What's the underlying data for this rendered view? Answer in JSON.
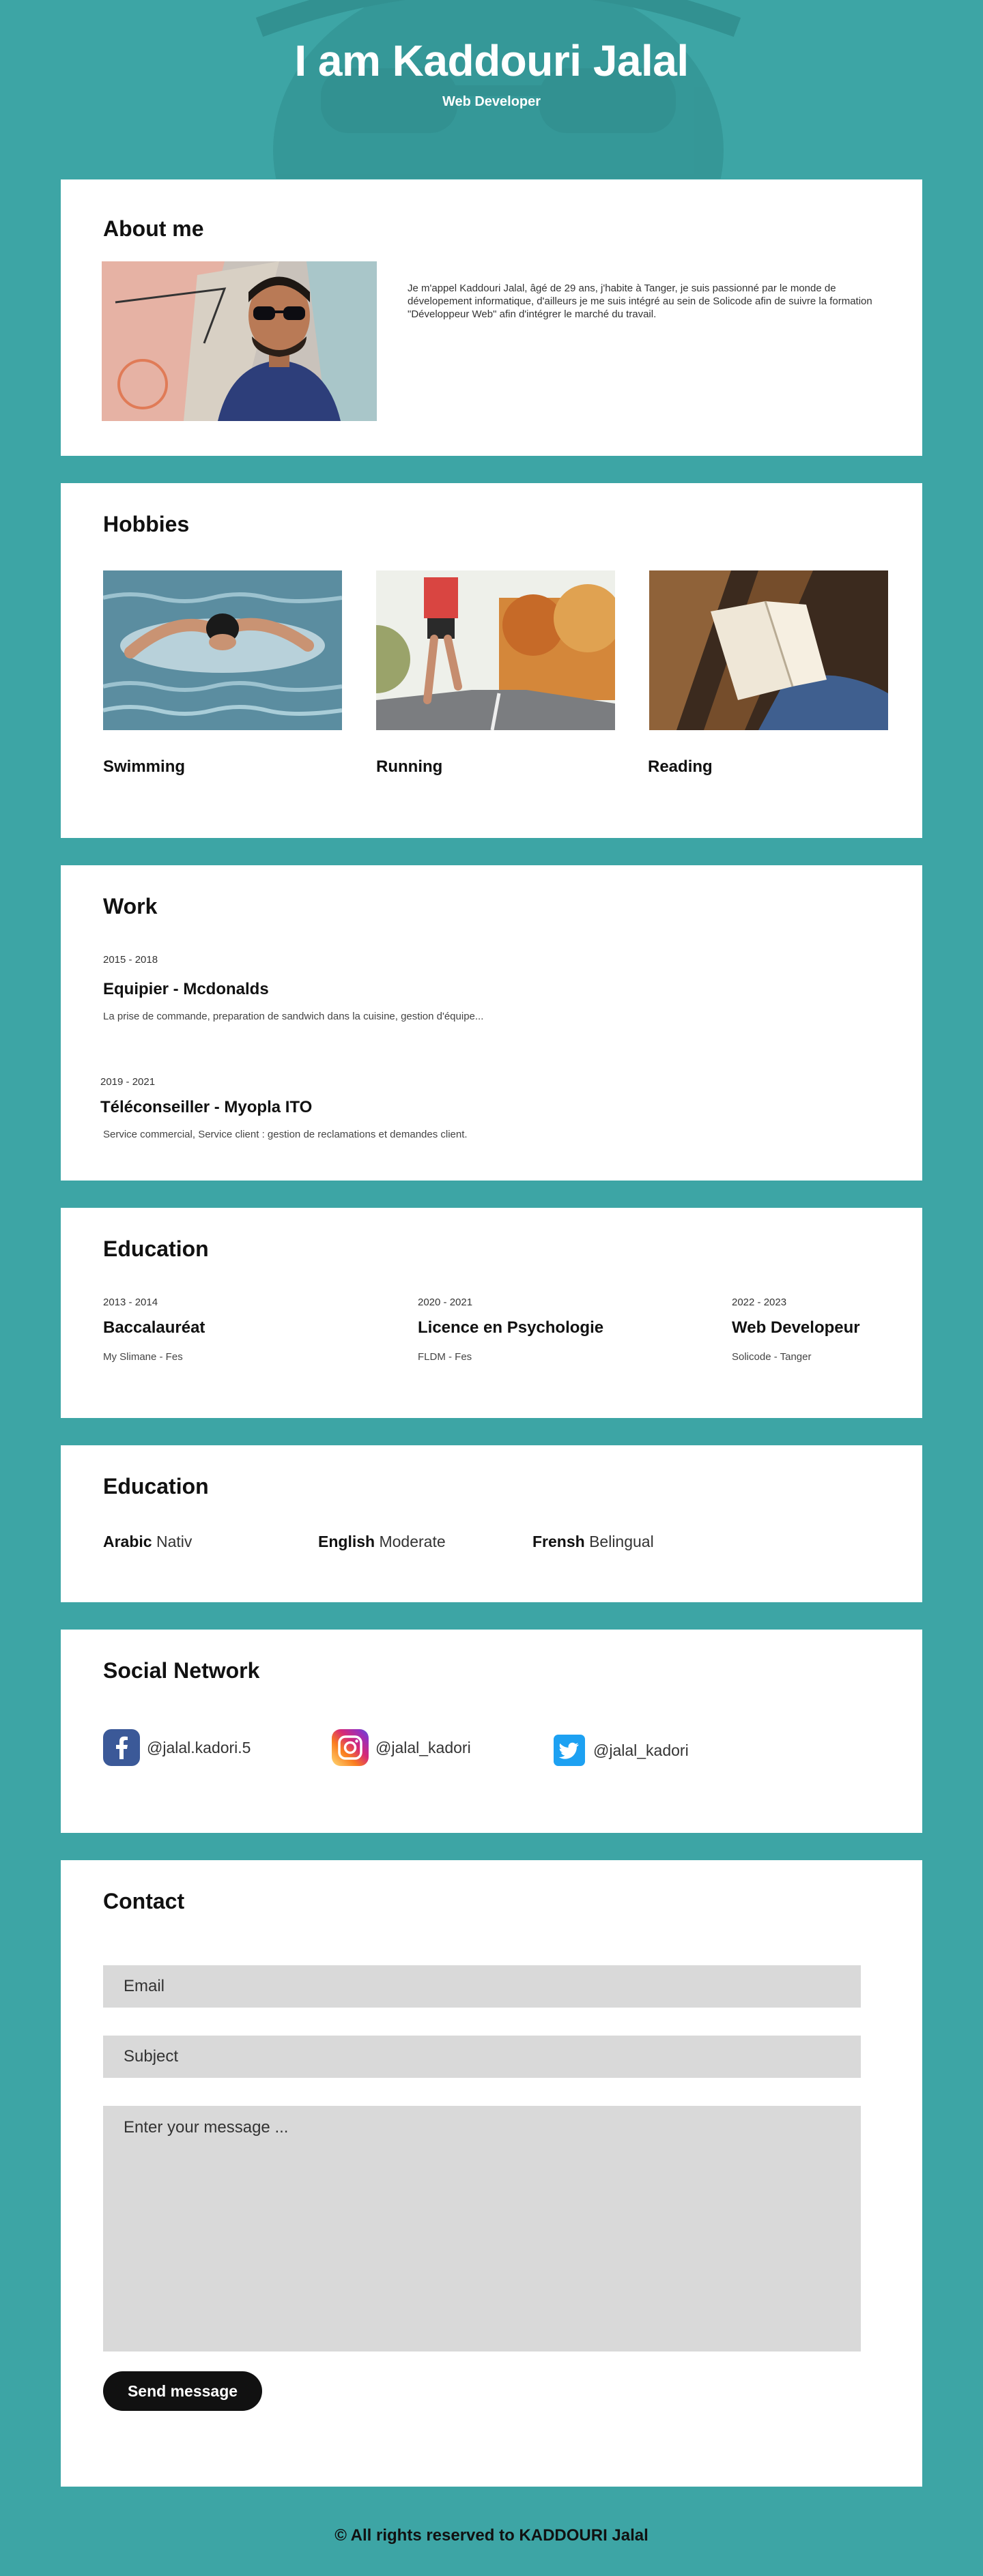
{
  "hero": {
    "title": "I am Kaddouri Jalal",
    "subtitle": "Web Developer"
  },
  "about": {
    "title": "About me",
    "text": "Je m'appel Kaddouri Jalal, âgé de 29 ans, j'habite à Tanger, je suis passionné par le monde de dévelopement informatique, d'ailleurs je me suis intégré au sein de Solicode afin de suivre la formation \"Développeur Web\" afin d'intégrer le marché du travail."
  },
  "hobbies": {
    "title": "Hobbies",
    "items": [
      {
        "label": "Swimming"
      },
      {
        "label": "Running"
      },
      {
        "label": "Reading"
      }
    ]
  },
  "work": {
    "title": "Work",
    "jobs": [
      {
        "date": "2015 - 2018",
        "title": "Equipier - Mcdonalds",
        "description": "La prise de commande, preparation de sandwich dans la cuisine, gestion d'équipe..."
      },
      {
        "date": "2019 - 2021",
        "title": "Téléconseiller - Myopla ITO",
        "description": "Service commercial, Service client : gestion de reclamations et demandes client."
      }
    ]
  },
  "education": {
    "title": "Education",
    "items": [
      {
        "date": "2013 - 2014",
        "title": "Baccalauréat",
        "place": "My Slimane - Fes"
      },
      {
        "date": "2020 - 2021",
        "title": "Licence en Psychologie",
        "place": "FLDM - Fes"
      },
      {
        "date": "2022 - 2023",
        "title": "Web Developeur",
        "place": "Solicode - Tanger"
      }
    ]
  },
  "languages": {
    "title": "Education",
    "items": [
      {
        "name": "Arabic",
        "level": "Nativ"
      },
      {
        "name": "English",
        "level": "Moderate"
      },
      {
        "name": "Frensh",
        "level": "Belingual"
      }
    ]
  },
  "social": {
    "title": "Social Network",
    "items": [
      {
        "icon": "facebook-icon",
        "handle": "@jalal.kadori.5",
        "color": "#3b5998"
      },
      {
        "icon": "instagram-icon",
        "handle": "@jalal_kadori",
        "color": "#c13584"
      },
      {
        "icon": "twitter-icon",
        "handle": "@jalal_kadori",
        "color": "#1da1f2"
      }
    ]
  },
  "contact": {
    "title": "Contact",
    "email_placeholder": "Email",
    "subject_placeholder": "Subject",
    "message_placeholder": "Enter your message ...",
    "send_label": "Send message"
  },
  "footer": {
    "text": "©  All rights reserved to KADDOURI Jalal"
  },
  "colors": {
    "page_background": "#3da5a5",
    "card_background": "#ffffff",
    "input_background": "#d9d9d9",
    "button_background": "#111111"
  }
}
